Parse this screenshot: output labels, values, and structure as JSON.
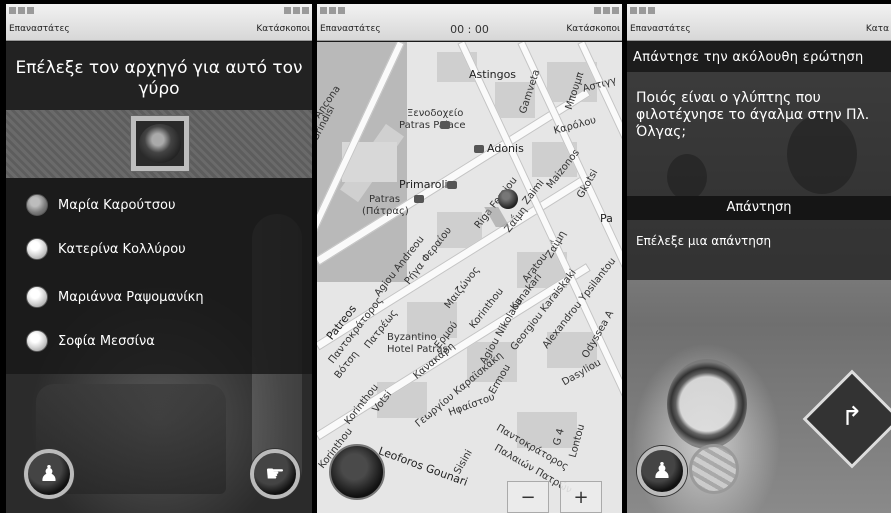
{
  "screens": [
    {
      "status_left": "Επαναστάτες",
      "status_right": "Κατάσκοποι",
      "title": "Επέλεξε τον αρχηγό για αυτό τον γύρο",
      "options": [
        "Μαρία Καρούτσου",
        "Κατερίνα Κολλύρου",
        "Μαριάννα Ραψομανίκη",
        "Σοφία Μεσσίνα"
      ],
      "selected_index": 0
    },
    {
      "status_left": "Επαναστάτες",
      "status_right": "Κατάσκοποι",
      "timer": "00 : 00",
      "map_labels": {
        "astingos": "Astingos",
        "gamveta": "Gamveta",
        "mpoumoul": "Μπουμπ",
        "astigkos": "Αστιγγ",
        "hotel_gr": "Ξενοδοχείο",
        "hotel_en": "Patras Palace",
        "adonis": "Adonis",
        "kapolou": "Καρόλου",
        "maizonos": "Maizonos",
        "gkotsi": "Gkotsi",
        "primarolia": "Primarolia",
        "patras": "Patras",
        "patras_gr": "(Πάτρας)",
        "riga": "Riga Feraiou",
        "zaimi": "Zaimi",
        "pa": "Pa",
        "agiou_andreou": "Agiou Andreou",
        "rigafer_gr": "Ρήγα Φεραίου",
        "zaimi_gr": "Ζαΐμη",
        "aratou": "Aratou",
        "zaimi2": "Ζαΐμη",
        "byzantino": "Byzantino",
        "byzantino_hotel": "Hotel Patras",
        "maizonos_gr": "Μαιζώνος",
        "korinthou": "Korinthou",
        "kanakari": "Kanakari",
        "karaiskaki": "Georgiou Karaiskaki",
        "ypsilantou": "Alexandrou Ypsilantou",
        "odyssea": "Odyssea A",
        "patreos": "Patreos",
        "pantokratoros_gr": "Παντοκράτορος",
        "boton_gr": "Βότση",
        "patreos_gr": "Πατρέως",
        "agiou_nikolaou": "Agiou Nikolaou",
        "ermou": "Ερμού",
        "kapakari": "Κανακάρη",
        "karaiskaki_gr": "Γεωργίου Καραϊσκάκη",
        "korinthou2": "Korinthou",
        "votsi": "Votsi",
        "hfaistou": "Ηφαίστου",
        "ermou2": "Ermou",
        "dasyliou": "Dasyliou",
        "pantokratoros": "Παντοκράτορος",
        "korinthou3": "Korinthou",
        "leoforos": "Leoforos Gounari",
        "sisini": "Sisini",
        "palaion_patron": "Παλαιών Πατρών",
        "lontou": "Lontou",
        "g4": "G 4",
        "ancona": "Ancona",
        "brindisi": "Brindisi"
      },
      "zoom_out": "−",
      "zoom_in": "+"
    },
    {
      "status_left": "Επαναστάτες",
      "status_right": "Κατα",
      "question_header": "Απάντησε την ακόλουθη ερώτηση",
      "question": "Ποιός είναι ο γλύπτης που φιλοτέχνησε το άγαλμα στην Πλ. Όλγας;",
      "answer_header": "Απάντηση",
      "answer_prompt": "Επέλεξε μια απάντηση"
    }
  ],
  "icons": {
    "leader": "person-board-icon",
    "next": "pointing-hand-icon",
    "record": "record-icon",
    "map": "map-icon"
  }
}
